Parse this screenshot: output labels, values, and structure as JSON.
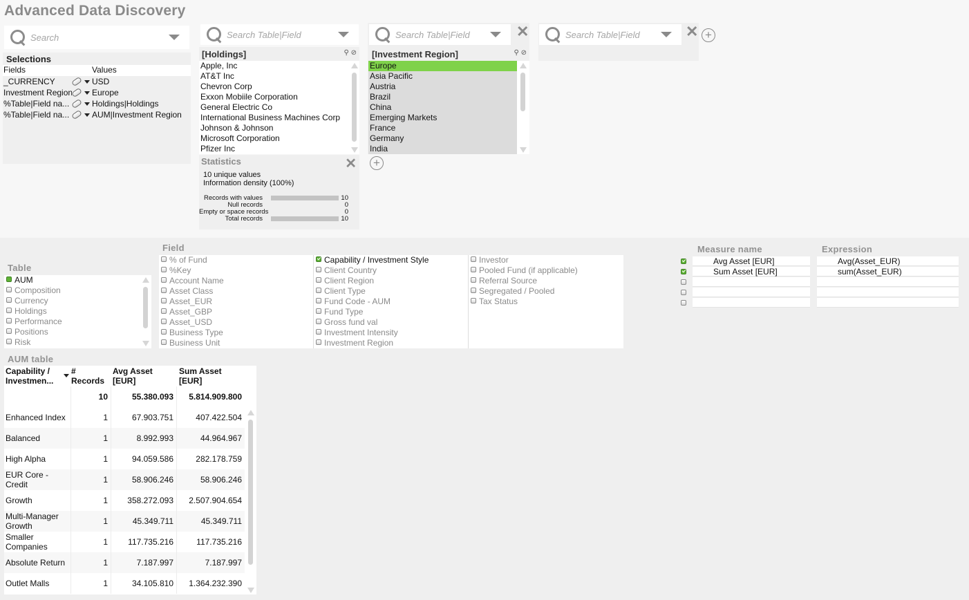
{
  "app": {
    "title": "Advanced Data Discovery"
  },
  "colors": {
    "selected": "#7fd24a",
    "excluded": "#dcdcdc",
    "check_on": "#5fb336",
    "title_gray": "#8a8a8a"
  },
  "selections": {
    "search_placeholder": "Search",
    "title": "Selections",
    "col_fields": "Fields",
    "col_values": "Values",
    "rows": [
      {
        "field": "_CURRENCY",
        "value": "USD"
      },
      {
        "field": "Investment Region",
        "value": "Europe"
      },
      {
        "field": "%Table|Field na...",
        "value": "Holdings|Holdings"
      },
      {
        "field": "%Table|Field na...",
        "value": "AUM|Investment Region"
      }
    ]
  },
  "listbox1": {
    "search_placeholder": "Search Table|Field",
    "title": "[Holdings]",
    "items": [
      "Apple, Inc",
      "AT&T Inc",
      "Chevron Corp",
      "Exxon Mobiile Corporation",
      "General Electric Co",
      "International Business Machines Corp",
      "Johnson & Johnson",
      "Microsoft Corporation",
      "Pfizer Inc"
    ]
  },
  "statistics": {
    "title": "Statistics",
    "unique": "10 unique values",
    "density": "Information density (100%)",
    "rows": [
      {
        "label": "Records with values",
        "value": "10",
        "fill": 1.0
      },
      {
        "label": "Null records",
        "value": "0",
        "fill": 0
      },
      {
        "label": "Empty or space records",
        "value": "0",
        "fill": 0
      },
      {
        "label": "Total records",
        "value": "10",
        "fill": 1.0
      }
    ]
  },
  "listbox2": {
    "search_placeholder": "Search Table|Field",
    "title": "[Investment Region]",
    "items": [
      {
        "label": "Europe",
        "state": "selected"
      },
      {
        "label": "Asia Pacific",
        "state": "excluded"
      },
      {
        "label": "Austria",
        "state": "excluded"
      },
      {
        "label": "Brazil",
        "state": "excluded"
      },
      {
        "label": "China",
        "state": "excluded"
      },
      {
        "label": "Emerging Markets",
        "state": "excluded"
      },
      {
        "label": "France",
        "state": "excluded"
      },
      {
        "label": "Germany",
        "state": "excluded"
      },
      {
        "label": "India",
        "state": "excluded"
      }
    ]
  },
  "listbox3": {
    "search_placeholder": "Search Table|Field"
  },
  "tables": {
    "label": "Table",
    "items": [
      {
        "label": "AUM",
        "checked": true
      },
      {
        "label": "Composition",
        "checked": false
      },
      {
        "label": "Currency",
        "checked": false
      },
      {
        "label": "Holdings",
        "checked": false
      },
      {
        "label": "Performance",
        "checked": false
      },
      {
        "label": "Positions",
        "checked": false
      },
      {
        "label": "Risk",
        "checked": false
      }
    ]
  },
  "fields": {
    "label": "Field",
    "col1": [
      {
        "label": "% of Fund",
        "checked": false
      },
      {
        "label": "%Key",
        "checked": false
      },
      {
        "label": "Account Name",
        "checked": false
      },
      {
        "label": "Asset Class",
        "checked": false
      },
      {
        "label": "Asset_EUR",
        "checked": false
      },
      {
        "label": "Asset_GBP",
        "checked": false
      },
      {
        "label": "Asset_USD",
        "checked": false
      },
      {
        "label": "Business Type",
        "checked": false
      },
      {
        "label": "Business Unit",
        "checked": false
      }
    ],
    "col2": [
      {
        "label": "Capability / Investment Style",
        "checked": true
      },
      {
        "label": "Client Country",
        "checked": false
      },
      {
        "label": "Client Region",
        "checked": false
      },
      {
        "label": "Client Type",
        "checked": false
      },
      {
        "label": "Fund Code - AUM",
        "checked": false
      },
      {
        "label": "Fund Type",
        "checked": false
      },
      {
        "label": "Gross fund val",
        "checked": false
      },
      {
        "label": "Investment Intensity",
        "checked": false
      },
      {
        "label": "Investment Region",
        "checked": false
      }
    ],
    "col3": [
      {
        "label": "Investor",
        "checked": false
      },
      {
        "label": "Pooled Fund (if applicable)",
        "checked": false
      },
      {
        "label": "Referral Source",
        "checked": false
      },
      {
        "label": "Segregated / Pooled",
        "checked": false
      },
      {
        "label": "Tax Status",
        "checked": false
      }
    ]
  },
  "measures": {
    "name_label": "Measure name",
    "expr_label": "Expression",
    "rows": [
      {
        "checked": true,
        "name": "Avg Asset [EUR]",
        "expr": "Avg(Asset_EUR)"
      },
      {
        "checked": true,
        "name": "Sum Asset [EUR]",
        "expr": "sum(Asset_EUR)"
      },
      {
        "checked": false,
        "name": "",
        "expr": ""
      },
      {
        "checked": false,
        "name": "",
        "expr": ""
      },
      {
        "checked": false,
        "name": "",
        "expr": ""
      }
    ]
  },
  "aum_table": {
    "title": "AUM table",
    "headers": [
      "Capability / Investmen...",
      "# Records",
      "Avg Asset [EUR]",
      "Sum Asset [EUR]"
    ],
    "totals": [
      "",
      "10",
      "55.380.093",
      "5.814.909.800"
    ],
    "rows": [
      [
        "Enhanced Index",
        "1",
        "67.903.751",
        "407.422.504"
      ],
      [
        "Balanced",
        "1",
        "8.992.993",
        "44.964.967"
      ],
      [
        "High Alpha",
        "1",
        "94.059.586",
        "282.178.759"
      ],
      [
        "EUR Core - Credit",
        "1",
        "58.906.246",
        "58.906.246"
      ],
      [
        "Growth",
        "1",
        "358.272.093",
        "2.507.904.654"
      ],
      [
        "Multi-Manager Growth",
        "1",
        "45.349.711",
        "45.349.711"
      ],
      [
        "Smaller Companies",
        "1",
        "117.735.216",
        "117.735.216"
      ],
      [
        "Absolute Return",
        "1",
        "7.187.997",
        "7.187.997"
      ],
      [
        "Outlet Malls",
        "1",
        "34.105.810",
        "1.364.232.390"
      ]
    ]
  }
}
